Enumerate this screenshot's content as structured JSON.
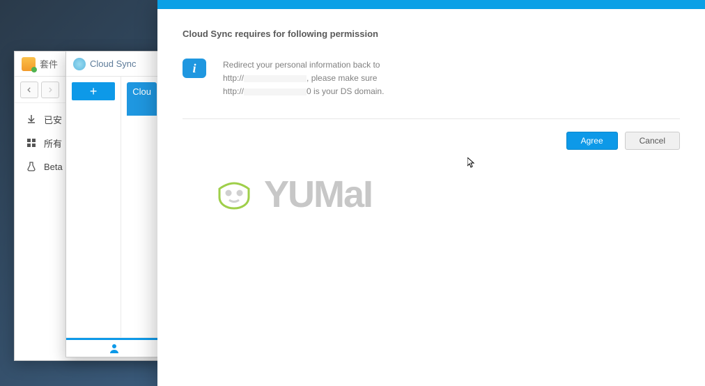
{
  "pkg": {
    "title": "套件",
    "sidebar": {
      "installed": "已安",
      "all": "所有",
      "beta": "Beta"
    }
  },
  "cloudSync": {
    "title": "Cloud Sync",
    "tabLabel": "Clou"
  },
  "dialog": {
    "title": "Cloud Sync requires for following permission",
    "info": {
      "line1_prefix": "Redirect your personal information back to",
      "line2_prefix": "http://",
      "line2_suffix": ", please make sure",
      "line3_prefix": "http://",
      "line3_suffix": "0 is your DS domain."
    },
    "buttons": {
      "agree": "Agree",
      "cancel": "Cancel"
    }
  },
  "watermark": {
    "text": "YUMaI"
  }
}
